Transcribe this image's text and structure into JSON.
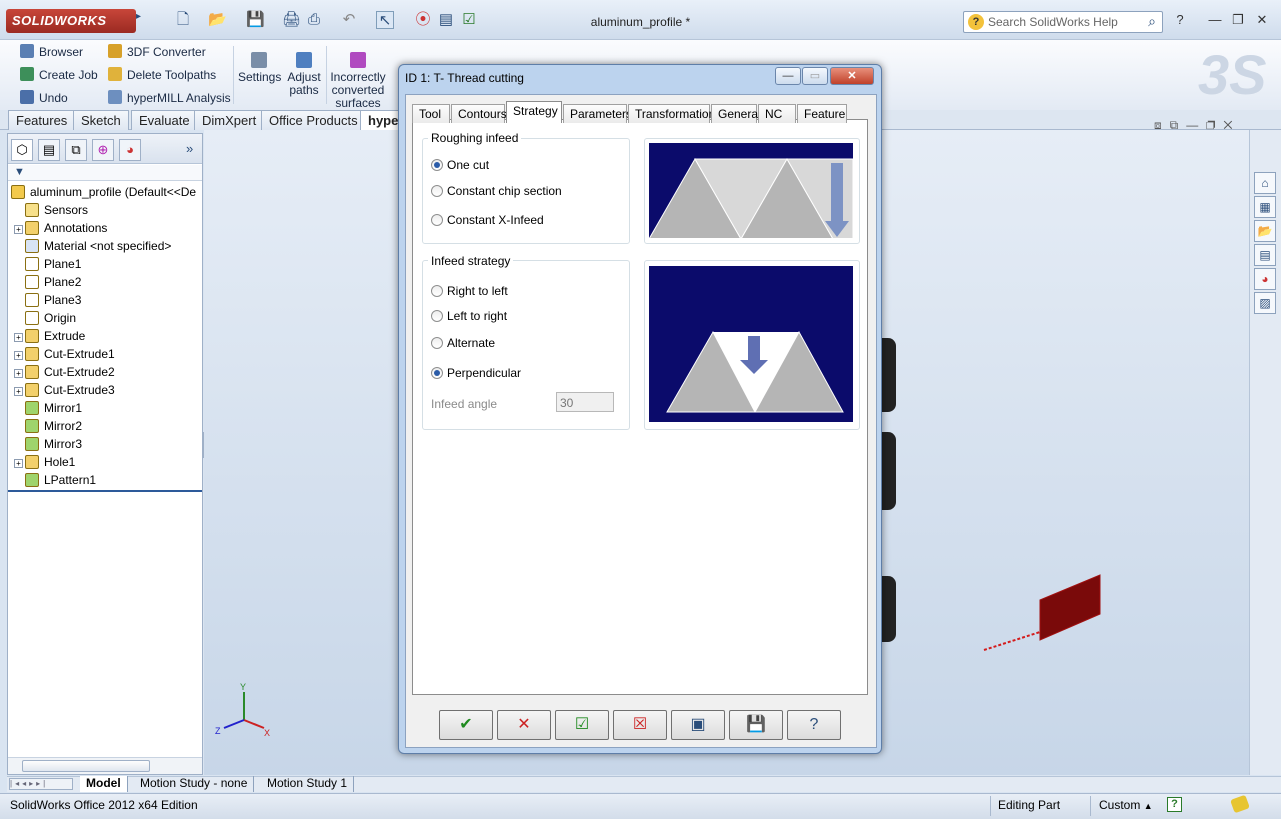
{
  "app": {
    "logo_text": "SOLIDWORKS",
    "document_title": "aluminum_profile *",
    "help_search_placeholder": "Search SolidWorks Help"
  },
  "command_manager": {
    "col1": [
      "Browser",
      "Create Job",
      "Undo"
    ],
    "col2": [
      "3DF Converter",
      "Delete Toolpaths",
      "hyperMILL Analysis"
    ],
    "settings": "Settings",
    "adjust_paths": [
      "Adjust",
      "paths"
    ],
    "incorrect": [
      "Incorrectly",
      "converted",
      "surfaces"
    ]
  },
  "tabs": [
    "Features",
    "Sketch",
    "Evaluate",
    "DimXpert",
    "Office Products",
    "hyper"
  ],
  "feature_tree": {
    "root": "aluminum_profile  (Default<<De",
    "items": [
      {
        "label": "Sensors",
        "expandable": false
      },
      {
        "label": "Annotations",
        "expandable": true
      },
      {
        "label": "Material <not specified>",
        "expandable": false
      },
      {
        "label": "Plane1",
        "expandable": false
      },
      {
        "label": "Plane2",
        "expandable": false
      },
      {
        "label": "Plane3",
        "expandable": false
      },
      {
        "label": "Origin",
        "expandable": false
      },
      {
        "label": "Extrude",
        "expandable": true
      },
      {
        "label": "Cut-Extrude1",
        "expandable": true
      },
      {
        "label": "Cut-Extrude2",
        "expandable": true
      },
      {
        "label": "Cut-Extrude3",
        "expandable": true
      },
      {
        "label": "Mirror1",
        "expandable": false
      },
      {
        "label": "Mirror2",
        "expandable": false
      },
      {
        "label": "Mirror3",
        "expandable": false
      },
      {
        "label": "Hole1",
        "expandable": true
      },
      {
        "label": "LPattern1",
        "expandable": false
      }
    ]
  },
  "motion_tabs": [
    "Model",
    "Motion Study - none",
    "Motion Study 1"
  ],
  "status": {
    "edition": "SolidWorks Office 2012 x64 Edition",
    "mode": "Editing Part",
    "units": "Custom"
  },
  "dialog": {
    "title": "ID 1: T- Thread cutting",
    "tabs": [
      "Tool",
      "Contours",
      "Strategy",
      "Parameters",
      "Transformation",
      "General",
      "NC",
      "Feature"
    ],
    "active_tab": "Strategy",
    "roughing_infeed": {
      "label": "Roughing  infeed",
      "options": [
        "One cut",
        "Constant chip section",
        "Constant X-Infeed"
      ],
      "selected": 0
    },
    "infeed_strategy": {
      "label": "Infeed strategy",
      "options": [
        "Right to left",
        "Left to right",
        "Alternate",
        "Perpendicular"
      ],
      "selected": 3
    },
    "infeed_angle": {
      "label": "Infeed angle",
      "value": "30"
    },
    "footer_buttons": [
      "ok-check",
      "cancel-x",
      "apply-check",
      "discard-x",
      "preview",
      "save",
      "help"
    ]
  },
  "colors": {
    "accent": "#2b5ca8",
    "diagram_bg": "#0b0b6b",
    "diagram_gray": "#b5b5b5",
    "part_red": "#7a0a0a"
  }
}
